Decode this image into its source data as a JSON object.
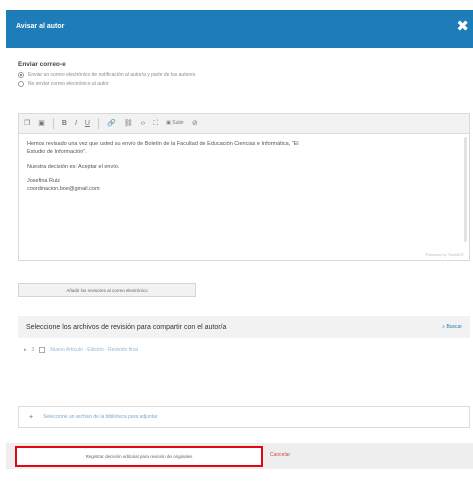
{
  "dialog": {
    "title": "Avisar al autor",
    "close_glyph": "✖"
  },
  "notify": {
    "section_label": "Enviar correo-e",
    "options": [
      {
        "label": "Enviar un correo electrónico de notificación al autor/a y parte de los autores",
        "checked": true
      },
      {
        "label": "No enviar correo electrónico al autor",
        "checked": false
      }
    ]
  },
  "editor": {
    "toolbar_icons": [
      "copy-icon",
      "paste-icon",
      "bold-icon",
      "italic-icon",
      "underline-icon",
      "link-icon",
      "unlink-icon",
      "code-icon",
      "fullscreen-icon",
      "image-icon",
      "clear-format-icon"
    ],
    "toolbar_upload_label": "Subir",
    "paragraphs": [
      "Hemos revisado una vez que usted su envío de Boletín de la Facultad de Educación Ciencias e Informática, \"El",
      "Estudio de Información\".",
      "Nuestra decisión es: Aceptar el envío.",
      "Josefina Ruiz",
      "coordinacion.boe@gmail.com"
    ],
    "status": "Powered by TinyMCE"
  },
  "add_review_button": "Añadir los revisores al correo electrónico",
  "files": {
    "header": "Seleccione los archivos de revisión para compartir con el autor/a",
    "browse": "Buscar",
    "rows": [
      {
        "id": "3",
        "crumbs": "Nuevo Artículo - Edición - Revisión final"
      }
    ]
  },
  "upload": {
    "plus": "+",
    "text": "Seleccione un archivo de la biblioteca para adjuntar"
  },
  "footer": {
    "send_button": "Registrar decisión editorial para revisión de originales",
    "cancel": "Cancelar"
  },
  "colors": {
    "header_blue": "#1e7cb8",
    "highlight_red": "#e30613"
  }
}
